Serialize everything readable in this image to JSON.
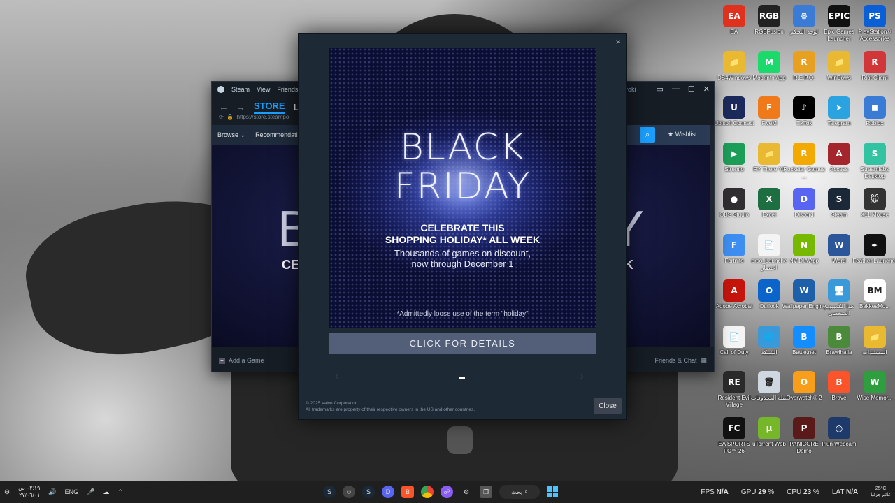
{
  "desktop_icons": [
    {
      "label": "EA",
      "color": "#e0301e",
      "glyph": "EA"
    },
    {
      "label": "RGBFusion",
      "color": "#222222",
      "glyph": "RGB"
    },
    {
      "label": "لوحة التحكم",
      "color": "#3a7bd5",
      "glyph": "⚙"
    },
    {
      "label": "Epic Games Launcher",
      "color": "#111111",
      "glyph": "EPIC"
    },
    {
      "label": "PlayStation® Accessories",
      "color": "#0b5fd6",
      "glyph": "PS"
    },
    {
      "label": "DS4Windows",
      "color": "#e8b931",
      "glyph": "📁"
    },
    {
      "label": "Modrinth App",
      "color": "#1bd96a",
      "glyph": "M"
    },
    {
      "label": "R.E.P.O.",
      "color": "#e8a020",
      "glyph": "R"
    },
    {
      "label": "WinDows",
      "color": "#e8b931",
      "glyph": "📁"
    },
    {
      "label": "Riot Client",
      "color": "#d13639",
      "glyph": "R"
    },
    {
      "label": "Ubisoft Connect",
      "color": "#1b2a5a",
      "glyph": "U"
    },
    {
      "label": "FiveM",
      "color": "#f07a1a",
      "glyph": "F"
    },
    {
      "label": "TikTok",
      "color": "#000000",
      "glyph": "♪"
    },
    {
      "label": "Telegram",
      "color": "#2aa3e0",
      "glyph": "➤"
    },
    {
      "label": "Roblox",
      "color": "#3a7bd5",
      "glyph": "◼"
    },
    {
      "label": "Stremio",
      "color": "#1d9e58",
      "glyph": "▶"
    },
    {
      "label": "RY There Ye",
      "color": "#e8b931",
      "glyph": "📁"
    },
    {
      "label": "Rockstar Games ...",
      "color": "#f2a900",
      "glyph": "R"
    },
    {
      "label": "Access",
      "color": "#a4262c",
      "glyph": "A"
    },
    {
      "label": "Streamlabs Desktop",
      "color": "#31c3a2",
      "glyph": "S"
    },
    {
      "label": "OBS Studio",
      "color": "#302e31",
      "glyph": "●"
    },
    {
      "label": "Excel",
      "color": "#1d6f42",
      "glyph": "X"
    },
    {
      "label": "Discord",
      "color": "#5865f2",
      "glyph": "D"
    },
    {
      "label": "Steam",
      "color": "#1b2838",
      "glyph": "S"
    },
    {
      "label": "X11 Mouse",
      "color": "#333333",
      "glyph": "🐭"
    },
    {
      "label": "Fortnite",
      "color": "#3d8ef0",
      "glyph": "F"
    },
    {
      "label": "erso_Launche اختصار",
      "color": "#f4f4f4",
      "glyph": "📄"
    },
    {
      "label": "NVIDIA App",
      "color": "#76b900",
      "glyph": "N"
    },
    {
      "label": "Word",
      "color": "#2b579a",
      "glyph": "W"
    },
    {
      "label": "Feather Launcher",
      "color": "#111111",
      "glyph": "✒"
    },
    {
      "label": "Adobe Acrobat",
      "color": "#c4140c",
      "glyph": "A"
    },
    {
      "label": "Outlook",
      "color": "#0a64c9",
      "glyph": "O"
    },
    {
      "label": "Wallpaper Engine",
      "color": "#1d5fa8",
      "glyph": "W"
    },
    {
      "label": "هذا الكمبيوتر الشخصي",
      "color": "#3a9ad9",
      "glyph": "🖥"
    },
    {
      "label": "BakkesMo...",
      "color": "#ffffff",
      "glyph": "BM"
    },
    {
      "label": "Call of Duty",
      "color": "#f4f4f4",
      "glyph": "📄"
    },
    {
      "label": "الشبكة",
      "color": "#3a9ad9",
      "glyph": "🌐"
    },
    {
      "label": "Battle.net",
      "color": "#148eff",
      "glyph": "B"
    },
    {
      "label": "Brawlhalla",
      "color": "#4a8a3a",
      "glyph": "B"
    },
    {
      "label": "المستندات",
      "color": "#e8b931",
      "glyph": "📁"
    },
    {
      "label": "Resident Evil Village",
      "color": "#2a2a2a",
      "glyph": "RE"
    },
    {
      "label": "سلة المحذوفات",
      "color": "#cfd8e0",
      "glyph": "🗑"
    },
    {
      "label": "Overwatch® 2",
      "color": "#f99e1a",
      "glyph": "O"
    },
    {
      "label": "Brave",
      "color": "#fb542b",
      "glyph": "B"
    },
    {
      "label": "Wise Memor...",
      "color": "#2e9e3e",
      "glyph": "W"
    },
    {
      "label": "EA SPORTS FC™ 26",
      "color": "#111111",
      "glyph": "FC"
    },
    {
      "label": "uTorrent Web",
      "color": "#75b729",
      "glyph": "µ"
    },
    {
      "label": "PANICORE Demo",
      "color": "#5a1a1a",
      "glyph": "P"
    },
    {
      "label": "Iriun Webcam",
      "color": "#1e3a6a",
      "glyph": "◎"
    }
  ],
  "steam_window": {
    "menu": [
      "Steam",
      "View",
      "Friends",
      "G"
    ],
    "user": "roki",
    "tabs": [
      "STORE",
      "LIBR"
    ],
    "url": "https://store.steampo",
    "storebar": [
      "Browse ⌄",
      "Recommendatio"
    ],
    "wishlist": "Wishlist",
    "banner_left": "B",
    "banner_right": "Y",
    "celebrate_left": "CE",
    "celebrate_right": "K",
    "add_game": "Add a Game",
    "friends_chat": "Friends & Chat"
  },
  "modal": {
    "title_line1": "BLACK",
    "title_line2": "FRIDAY",
    "celebrate_line1": "CELEBRATE THIS",
    "celebrate_line2": "SHOPPING HOLIDAY* ALL WEEK",
    "sub_line1": "Thousands of games on discount,",
    "sub_line2": "now through December 1",
    "footnote": "*Admittedly loose use of the term \"holiday\"",
    "details_button": "CLICK FOR DETAILS",
    "copyright_line1": "© 2025 Valve Corporation.",
    "copyright_line2": "All trademarks are property of their respective owners in the US and other countries.",
    "close_button": "Close",
    "close_icon": "×",
    "prev_arrow": "‹",
    "next_arrow": "›"
  },
  "taskbar": {
    "clock_time": "٠٢:١٩ ص",
    "clock_date": "٢٧/٠٦/٠١",
    "language": "ENG",
    "search_label": "بحث",
    "fps_label": "FPS",
    "fps_value": "N/A",
    "gpu_label": "GPU",
    "gpu_value": "29",
    "gpu_unit": "%",
    "cpu_label": "CPU",
    "cpu_value": "23",
    "cpu_unit": "%",
    "lat_label": "LAT",
    "lat_value": "N/A",
    "temp": "25°C",
    "weather": "غائم جزئيا"
  }
}
